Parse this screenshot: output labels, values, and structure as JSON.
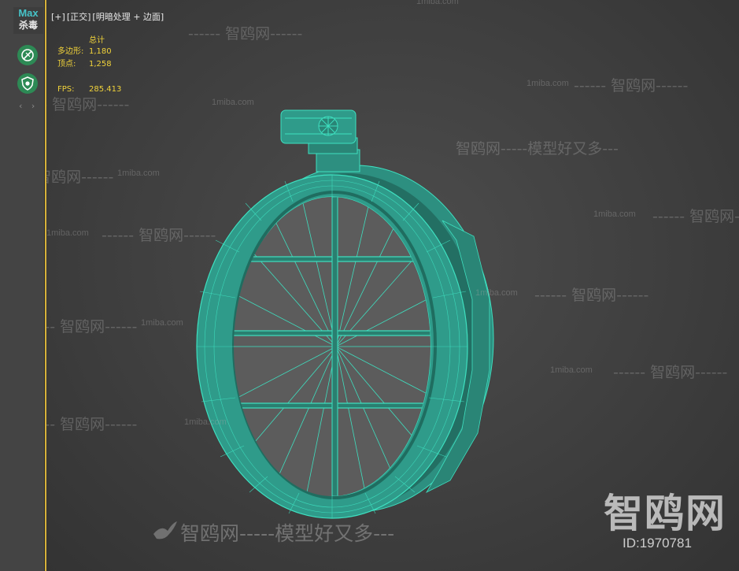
{
  "sidebar": {
    "logo_top": "Max",
    "logo_bottom": "杀毒",
    "buttons": [
      "scan-icon",
      "shield-bug-icon"
    ],
    "arrows": "‹ ›"
  },
  "viewport": {
    "label_plus": "[+]",
    "label_view": "[正交]",
    "label_shading": "[明暗处理 + 边面]"
  },
  "stats": {
    "title": "总计",
    "polygons_label": "多边形:",
    "polygons_value": "1,180",
    "vertices_label": "顶点:",
    "vertices_value": "1,258",
    "fps_label": "FPS:",
    "fps_value": "285.413"
  },
  "watermarks": {
    "site": "智鸥网",
    "slogan": "智鸥网-----模型好又多---",
    "domain": "1miba.com",
    "dash_site": "------ 智鸥网------",
    "big": "智鸥网",
    "id": "ID:1970781",
    "bottom": "智鸥网-----模型好又多---"
  },
  "colors": {
    "wire": "#3ee0c0",
    "accent": "#d6b13a",
    "stats_text": "#f0d23a"
  }
}
